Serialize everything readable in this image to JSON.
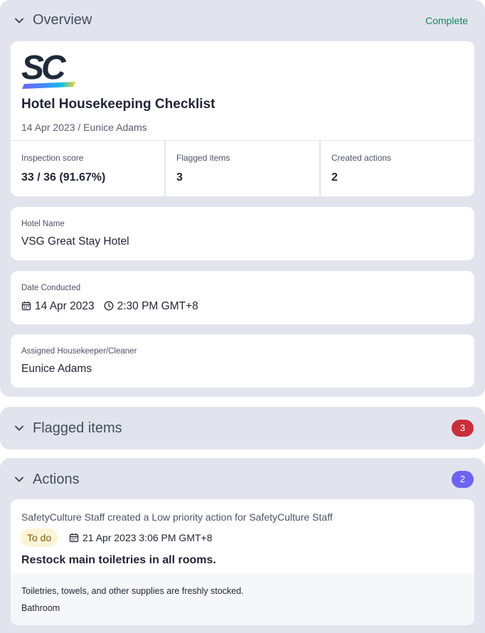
{
  "overview": {
    "title": "Overview",
    "status": "Complete",
    "document": {
      "logo_text": "SC",
      "title": "Hotel Housekeeping Checklist",
      "subtitle": "14 Apr 2023 / Eunice Adams"
    },
    "stats": [
      {
        "label": "Inspection score",
        "value": "33 / 36 (91.67%)"
      },
      {
        "label": "Flagged items",
        "value": "3"
      },
      {
        "label": "Created actions",
        "value": "2"
      }
    ],
    "fields": {
      "hotel_name": {
        "label": "Hotel Name",
        "value": "VSG Great Stay Hotel"
      },
      "date_conducted": {
        "label": "Date Conducted",
        "date": "14 Apr 2023",
        "time": "2:30 PM GMT+8"
      },
      "assignee": {
        "label": "Assigned Housekeeper/Cleaner",
        "value": "Eunice Adams"
      }
    }
  },
  "flagged": {
    "title": "Flagged items",
    "count": "3"
  },
  "actions": {
    "title": "Actions",
    "count": "2",
    "items": [
      {
        "meta": "SafetyCulture Staff created a Low priority action for SafetyCulture Staff",
        "status": "To do",
        "due": "21 Apr 2023 3:06 PM GMT+8",
        "title": "Restock main toiletries in all rooms.",
        "description": "Toiletries, towels, and other supplies are freshly stocked.",
        "location": "Bathroom"
      }
    ]
  },
  "colors": {
    "section_bg": "#e1e4ed",
    "complete_green": "#12875a",
    "flag_red": "#c8303a",
    "action_purple": "#6f63f2",
    "todo_bg": "#fdf4d7"
  },
  "icons": {
    "chevron": "chevron-down-icon",
    "calendar": "calendar-icon",
    "clock": "clock-icon"
  }
}
